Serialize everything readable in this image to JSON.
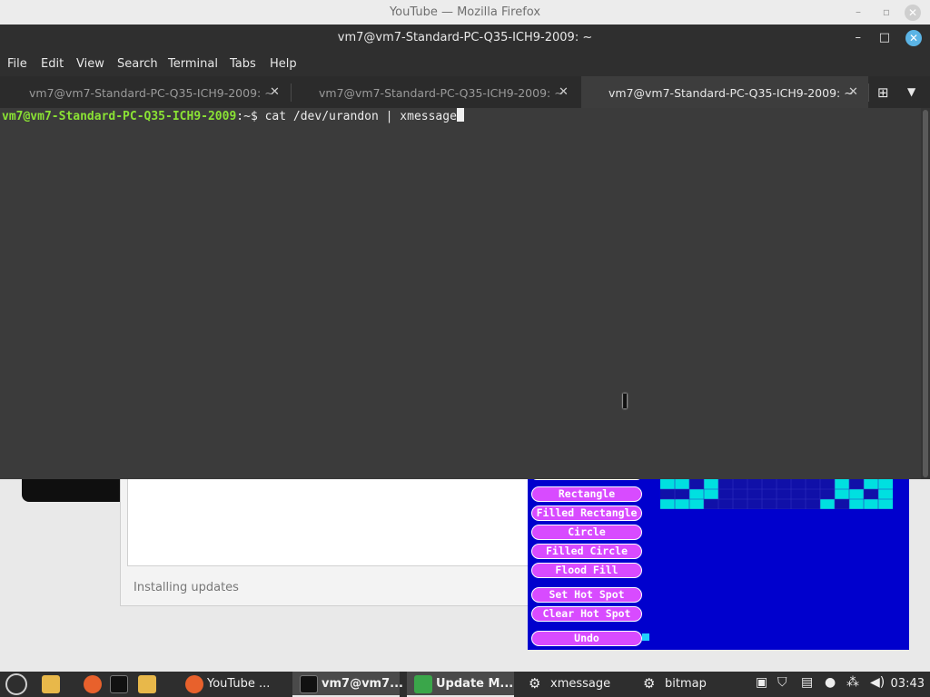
{
  "firefox": {
    "title": "YouTube — Mozilla Firefox"
  },
  "terminal": {
    "title": "vm7@vm7-Standard-PC-Q35-ICH9-2009: ~",
    "menu": [
      "File",
      "Edit",
      "View",
      "Search",
      "Terminal",
      "Tabs",
      "Help"
    ],
    "tabs": [
      "vm7@vm7-Standard-PC-Q35-ICH9-2009: ~",
      "vm7@vm7-Standard-PC-Q35-ICH9-2009: ~",
      "vm7@vm7-Standard-PC-Q35-ICH9-2009: ~"
    ],
    "prompt_user": "vm7@vm7-Standard-PC-Q35-ICH9-2009",
    "prompt_path": ":~",
    "prompt_symbol": "$ ",
    "command": "cat /dev/urandon | xmessage"
  },
  "update_manager": {
    "status": "Installing updates"
  },
  "bitmap": {
    "buttons": [
      "Rectangle",
      "Filled Rectangle",
      "Circle",
      "Filled Circle",
      "Flood Fill",
      "Set Hot Spot",
      "Clear Hot Spot",
      "Undo"
    ]
  },
  "taskbar": {
    "items": [
      "YouTube ...",
      "vm7@vm7...",
      "Update M...",
      "xmessage",
      "bitmap"
    ],
    "clock": "03:43"
  }
}
